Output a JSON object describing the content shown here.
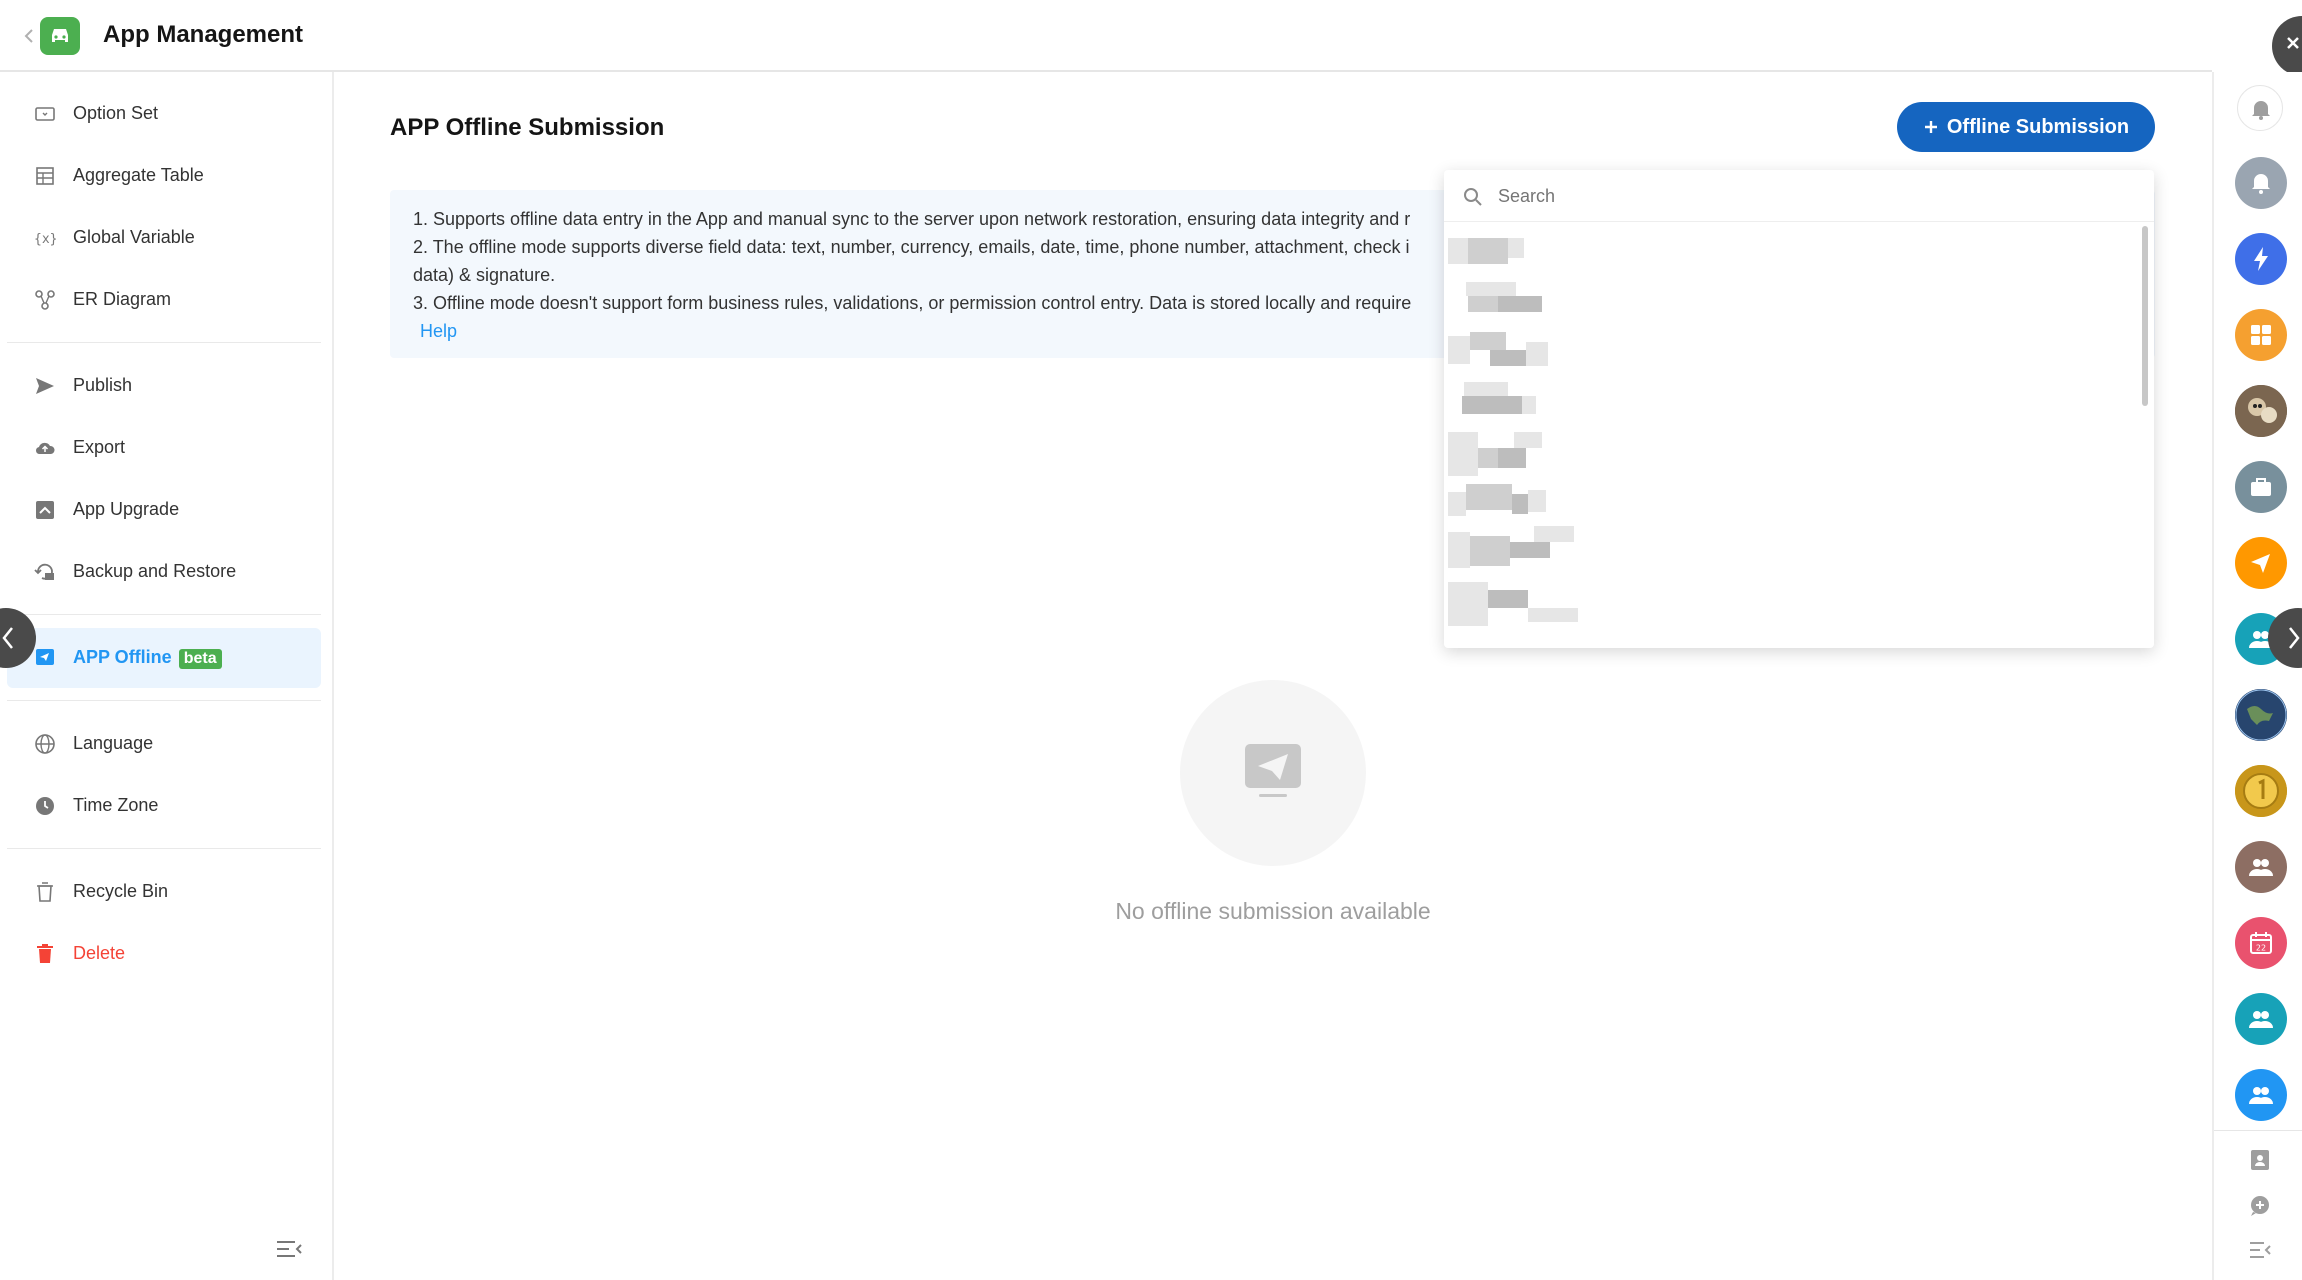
{
  "header": {
    "title": "App Management",
    "logo_icon": "car-icon",
    "logo_color": "#4caf50"
  },
  "sidebar": {
    "items": [
      {
        "label": "Option Set",
        "icon": "option-set-icon"
      },
      {
        "label": "Aggregate Table",
        "icon": "aggregate-table-icon"
      },
      {
        "label": "Global Variable",
        "icon": "variable-icon"
      },
      {
        "label": "ER Diagram",
        "icon": "er-diagram-icon"
      },
      {
        "label": "Publish",
        "icon": "send-icon"
      },
      {
        "label": "Export",
        "icon": "cloud-upload-icon"
      },
      {
        "label": "App Upgrade",
        "icon": "upgrade-icon"
      },
      {
        "label": "Backup and Restore",
        "icon": "backup-icon"
      },
      {
        "label": "APP Offline",
        "icon": "offline-icon",
        "badge": "beta",
        "active": true
      },
      {
        "label": "Language",
        "icon": "globe-icon"
      },
      {
        "label": "Time Zone",
        "icon": "clock-icon"
      },
      {
        "label": "Recycle Bin",
        "icon": "recycle-bin-icon"
      },
      {
        "label": "Delete",
        "icon": "trash-icon",
        "danger": true
      }
    ]
  },
  "main": {
    "title": "APP Offline Submission",
    "primary_button": "Offline Submission",
    "notice": {
      "line1": "1. Supports offline data entry in the App and manual sync to the server upon network restoration, ensuring data integrity and r",
      "line2": "2. The offline mode supports diverse field data: text, number, currency, emails, date, time, phone number, attachment, check i",
      "line3": "data) & signature.",
      "line4": "3. Offline mode doesn't support form business rules, validations, or permission control entry. Data is stored locally and require",
      "help": "Help"
    },
    "empty_text": "No offline submission available"
  },
  "dropdown": {
    "search_placeholder": "Search"
  },
  "colors": {
    "accent": "#2196f3",
    "primary_button": "#1565c0",
    "danger": "#f44336",
    "active_bg": "#eaf4fe"
  },
  "rail": {
    "icons": [
      "bell-icon",
      "lightning-icon",
      "grid-icon",
      "avatar-photo-icon",
      "briefcase-icon",
      "paper-plane-icon",
      "group-icon",
      "earth-icon",
      "coin-icon",
      "group-icon",
      "calendar-icon",
      "group-icon",
      "group-icon"
    ],
    "calendar_day": "22"
  }
}
